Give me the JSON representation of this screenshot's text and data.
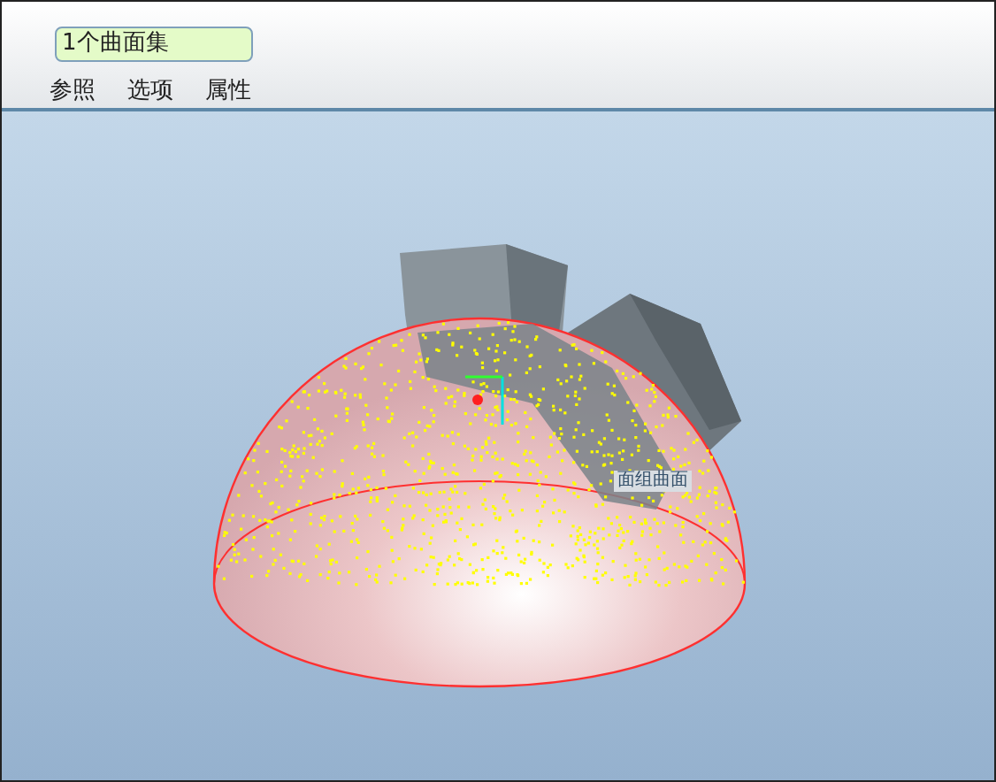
{
  "collector": {
    "value": "1个曲面集"
  },
  "tabs": [
    {
      "label": "参照"
    },
    {
      "label": "选项"
    },
    {
      "label": "属性"
    }
  ],
  "viewport": {
    "tag": "面组曲面"
  }
}
